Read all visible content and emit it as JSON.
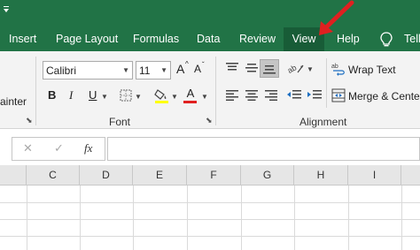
{
  "ribbon_tabs": [
    {
      "label": "Insert",
      "active": false
    },
    {
      "label": "Page Layout",
      "active": false
    },
    {
      "label": "Formulas",
      "active": false
    },
    {
      "label": "Data",
      "active": false
    },
    {
      "label": "Review",
      "active": false
    },
    {
      "label": "View",
      "active": true
    },
    {
      "label": "Help",
      "active": false
    },
    {
      "label": "Tell",
      "active": false
    }
  ],
  "clipboard": {
    "partial_label": "ainter"
  },
  "font_group": {
    "font_name": "Calibri",
    "font_size": "11",
    "grow_label": "A",
    "shrink_label": "A",
    "bold_label": "B",
    "italic_label": "I",
    "underline_label": "U",
    "font_color_label": "A",
    "group_label": "Font"
  },
  "alignment_group": {
    "wrap_text_label": "Wrap Text",
    "merge_label": "Merge & Center",
    "group_label": "Alignment"
  },
  "formula_bar": {
    "cancel_glyph": "✕",
    "enter_glyph": "✓",
    "fx_label": "fx"
  },
  "columns": [
    "C",
    "D",
    "E",
    "F",
    "G",
    "H",
    "I"
  ],
  "colors": {
    "tab_bar": "#217346",
    "active_tab": "#185c37",
    "pointer": "#e02020",
    "highlight": "#ffff00",
    "font_color": "#e02020"
  },
  "icons": [
    "quick-access-arrow-icon",
    "lightbulb-icon",
    "grow-font-icon",
    "shrink-font-icon",
    "borders-icon",
    "fill-color-icon",
    "font-color-icon",
    "align-top-icon",
    "align-middle-icon",
    "align-bottom-icon",
    "orientation-icon",
    "align-left-icon",
    "align-center-icon",
    "align-right-icon",
    "decrease-indent-icon",
    "increase-indent-icon",
    "wrap-text-icon",
    "merge-center-icon",
    "dialog-launcher-icon"
  ]
}
